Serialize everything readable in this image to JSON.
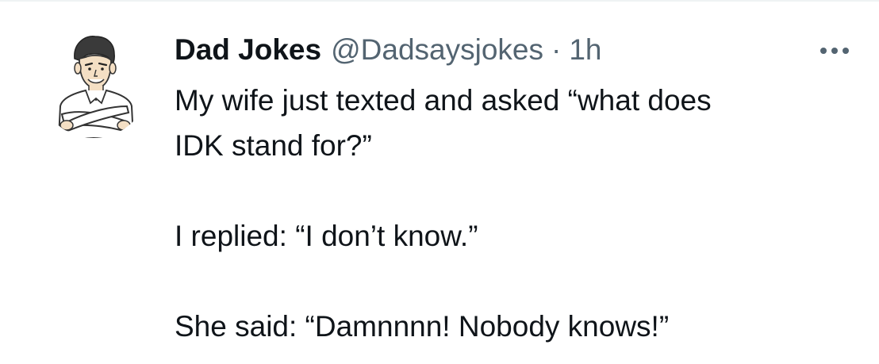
{
  "author": {
    "display_name": "Dad Jokes",
    "handle": "@Dadsaysjokes",
    "separator": "·",
    "timestamp": "1h",
    "avatar_icon": "cartoon-man-avatar"
  },
  "more_menu": {
    "icon": "more-horizontal-icon"
  },
  "tweet": {
    "lines": [
      "My wife just texted and asked “what does",
      "IDK stand for?”",
      "",
      "I replied: “I don’t know.”",
      "",
      "She said: “Damnnnn! Nobody knows!”"
    ]
  },
  "colors": {
    "primary_text": "#0f1419",
    "secondary_text": "#536471",
    "divider": "#eff3f4",
    "background": "#ffffff"
  }
}
